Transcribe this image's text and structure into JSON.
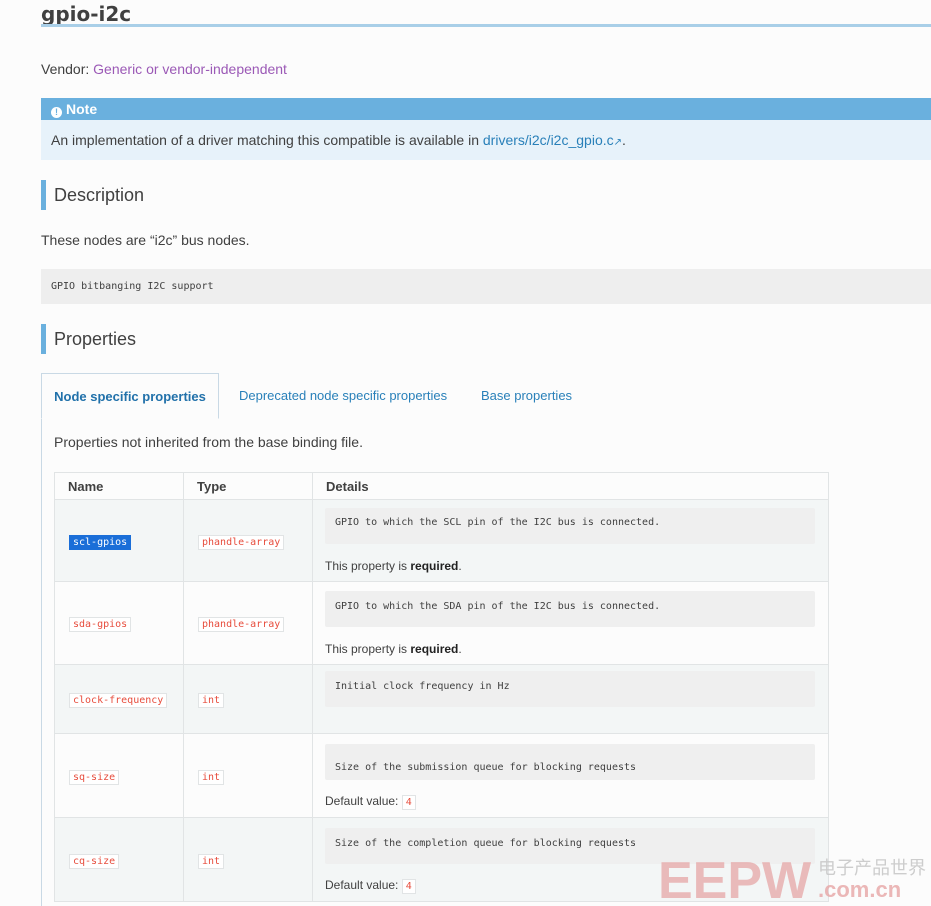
{
  "page": {
    "title": "gpio-i2c",
    "vendor_label": "Vendor:",
    "vendor_value": "Generic or vendor-independent"
  },
  "note": {
    "title": "Note",
    "text_before": "An implementation of a driver matching this compatible is available in",
    "link": "drivers/i2c/i2c_gpio.c",
    "text_after": "."
  },
  "description": {
    "heading": "Description",
    "text": "These nodes are “i2c” bus nodes.",
    "code": "GPIO bitbanging I2C support"
  },
  "properties": {
    "heading": "Properties",
    "tabs": [
      {
        "label": "Node specific properties"
      },
      {
        "label": "Deprecated node specific properties"
      },
      {
        "label": "Base properties"
      }
    ],
    "intro": "Properties not inherited from the base binding file.",
    "columns": {
      "name": "Name",
      "type": "Type",
      "details": "Details"
    },
    "rows": [
      {
        "name": "scl-gpios",
        "type": "phandle-array",
        "detail": "GPIO to which the SCL pin of the I2C bus is connected.",
        "note_prefix": "This property is",
        "note_bold": "required",
        "note_suffix": "."
      },
      {
        "name": "sda-gpios",
        "type": "phandle-array",
        "detail": "GPIO to which the SDA pin of the I2C bus is connected.",
        "note_prefix": "This property is",
        "note_bold": "required",
        "note_suffix": "."
      },
      {
        "name": "clock-frequency",
        "type": "int",
        "detail": "Initial clock frequency in Hz"
      },
      {
        "name": "sq-size",
        "type": "int",
        "detail": "Size of the submission queue for blocking requests",
        "default_label": "Default value:",
        "default_value": "4"
      },
      {
        "name": "cq-size",
        "type": "int",
        "detail": "Size of the completion queue for blocking requests",
        "default_label": "Default value:",
        "default_value": "4"
      }
    ]
  },
  "watermark": {
    "logo": "EEPW",
    "cn_text": "电子产品世界",
    "domain": ".com.cn"
  }
}
